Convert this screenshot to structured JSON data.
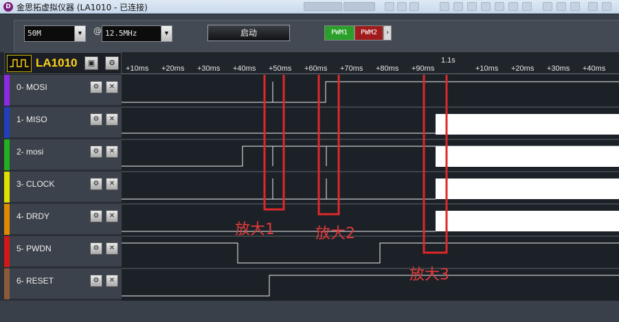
{
  "window": {
    "title": "金思拓虚拟仪器 (LA1010 - 已连接)",
    "logo_text": "D"
  },
  "toolbar": {
    "sample_depth": "50M",
    "at": "@",
    "sample_rate": "12.5MHz",
    "start_label": "启动",
    "pwm1_label": "PWM1",
    "pwm2_label": "PWM2",
    "pwm_next": "›",
    "dropdown_arrow": "▼"
  },
  "device": {
    "name": "LA1010",
    "icons": [
      "waveform-icon",
      "window-icon",
      "gear-icon"
    ]
  },
  "timeline": {
    "center_mark": "1.1s",
    "ticks_left": [
      "+10ms",
      "+20ms",
      "+30ms",
      "+40ms",
      "+50ms",
      "+60ms",
      "+70ms",
      "+80ms",
      "+90ms"
    ],
    "ticks_right": [
      "+10ms",
      "+20ms",
      "+30ms",
      "+40ms"
    ]
  },
  "channels": [
    {
      "label": "0-  MOSI",
      "color": "#8a2be2"
    },
    {
      "label": "1-  MISO",
      "color": "#1f3fbf"
    },
    {
      "label": "2-  mosi",
      "color": "#20b020"
    },
    {
      "label": "3-  CLOCK",
      "color": "#e0e000"
    },
    {
      "label": "4-  DRDY",
      "color": "#e08a00"
    },
    {
      "label": "5-  PWDN",
      "color": "#d01818"
    },
    {
      "label": "6-  RESET",
      "color": "#8a5a3a"
    }
  ],
  "channel_buttons": {
    "settings": "⚙",
    "close": "✕"
  },
  "annotations": {
    "zoom1": "放大1",
    "zoom2": "放大2",
    "zoom3": "放大3",
    "color": "#e02828"
  }
}
